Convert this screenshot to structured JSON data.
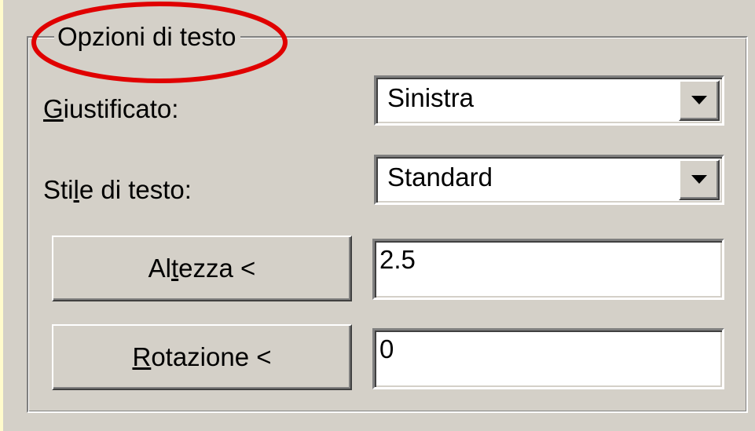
{
  "group": {
    "title": "Opzioni di testo"
  },
  "fields": {
    "justify": {
      "label_prefix": "",
      "label_mnemonic": "G",
      "label_suffix": "iustificato:",
      "value": "Sinistra"
    },
    "text_style": {
      "label_prefix": "Sti",
      "label_mnemonic": "l",
      "label_suffix": "e di testo:",
      "value": "Standard"
    },
    "height": {
      "button_prefix": "Al",
      "button_mnemonic": "t",
      "button_suffix": "ezza <",
      "value": "2.5"
    },
    "rotation": {
      "button_prefix": "",
      "button_mnemonic": "R",
      "button_suffix": "otazione <",
      "value": "0"
    }
  },
  "colors": {
    "highlight_ellipse": "#e00000",
    "dialog_background": "#d4d0c8",
    "page_background": "#fffbcc"
  },
  "icons": {
    "dropdown": "chevron-down-icon"
  }
}
